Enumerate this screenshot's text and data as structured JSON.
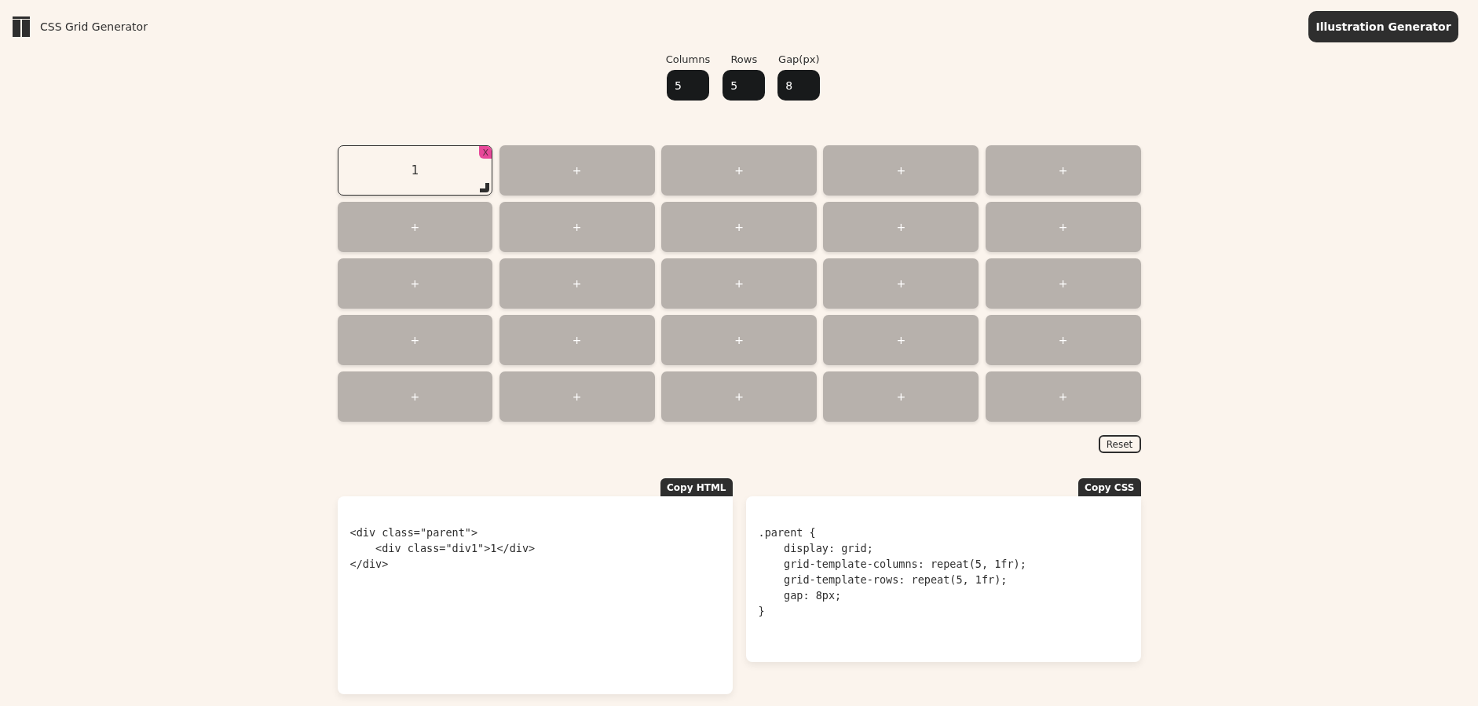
{
  "header": {
    "title": "CSS Grid Generator",
    "action": "Illustration Generator"
  },
  "settings": [
    {
      "label": "Columns",
      "value": "5"
    },
    {
      "label": "Rows",
      "value": "5"
    },
    {
      "label": "Gap(px)",
      "value": "8"
    }
  ],
  "grid": {
    "cells": [
      {
        "kind": "item",
        "label": "1",
        "close": "X"
      },
      {
        "kind": "empty",
        "label": "+"
      },
      {
        "kind": "empty",
        "label": "+"
      },
      {
        "kind": "empty",
        "label": "+"
      },
      {
        "kind": "empty",
        "label": "+"
      },
      {
        "kind": "empty",
        "label": "+"
      },
      {
        "kind": "empty",
        "label": "+"
      },
      {
        "kind": "empty",
        "label": "+"
      },
      {
        "kind": "empty",
        "label": "+"
      },
      {
        "kind": "empty",
        "label": "+"
      },
      {
        "kind": "empty",
        "label": "+"
      },
      {
        "kind": "empty",
        "label": "+"
      },
      {
        "kind": "empty",
        "label": "+"
      },
      {
        "kind": "empty",
        "label": "+"
      },
      {
        "kind": "empty",
        "label": "+"
      },
      {
        "kind": "empty",
        "label": "+"
      },
      {
        "kind": "empty",
        "label": "+"
      },
      {
        "kind": "empty",
        "label": "+"
      },
      {
        "kind": "empty",
        "label": "+"
      },
      {
        "kind": "empty",
        "label": "+"
      },
      {
        "kind": "empty",
        "label": "+"
      },
      {
        "kind": "empty",
        "label": "+"
      },
      {
        "kind": "empty",
        "label": "+"
      },
      {
        "kind": "empty",
        "label": "+"
      },
      {
        "kind": "empty",
        "label": "+"
      }
    ],
    "reset": "Reset"
  },
  "code_panels": [
    {
      "button": "Copy HTML",
      "lines": [
        "<div class=\"parent\">",
        "    <div class=\"div1\">1</div>",
        "</div>"
      ]
    },
    {
      "button": "Copy CSS",
      "lines": [
        ".parent {",
        "    display: grid;",
        "    grid-template-columns: repeat(5, 1fr);",
        "    grid-template-rows: repeat(5, 1fr);",
        "    gap: 8px;",
        "}"
      ]
    }
  ]
}
